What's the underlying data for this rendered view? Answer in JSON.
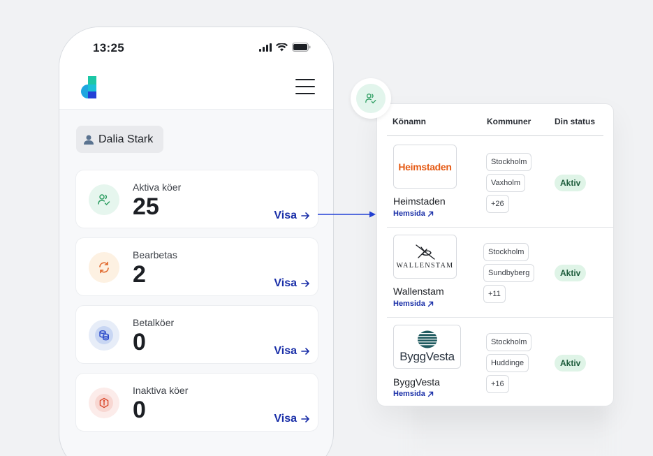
{
  "phone": {
    "status_time": "13:25",
    "user_name": "Dalia Stark",
    "cards": [
      {
        "label": "Aktiva köer",
        "value": "25",
        "link": "Visa",
        "icon": "users-check-icon",
        "accent": "#2f9e63",
        "bg": "#e6f6ee"
      },
      {
        "label": "Bearbetas",
        "value": "2",
        "link": "Visa",
        "icon": "refresh-icon",
        "accent": "#e0672a",
        "bg": "#fdf1e2"
      },
      {
        "label": "Betalköer",
        "value": "0",
        "link": "Visa",
        "icon": "coins-icon",
        "accent": "#2848c9",
        "bg": "#e7edf8"
      },
      {
        "label": "Inaktiva köer",
        "value": "0",
        "link": "Visa",
        "icon": "info-hexagon-icon",
        "accent": "#d9472b",
        "bg": "#fcecea"
      }
    ]
  },
  "table": {
    "headers": {
      "name": "Könamn",
      "municipalities": "Kommuner",
      "status": "Din status"
    },
    "rows": [
      {
        "logo_text": "Heimstaden",
        "company": "Heimstaden",
        "link": "Hemsida",
        "tags": [
          "Stockholm",
          "Vaxholm",
          "+26"
        ],
        "status": "Aktiv"
      },
      {
        "logo_text": "WALLENSTAM",
        "company": "Wallenstam",
        "link": "Hemsida",
        "tags": [
          "Stockholm",
          "Sundbyberg",
          "+11"
        ],
        "status": "Aktiv"
      },
      {
        "logo_text": "ByggVesta",
        "company": "ByggVesta",
        "link": "Hemsida",
        "tags": [
          "Stockholm",
          "Huddinge",
          "+16"
        ],
        "status": "Aktiv"
      }
    ]
  },
  "colors": {
    "accent_blue": "#1a2fa8",
    "status_green_bg": "#dff4e7"
  }
}
